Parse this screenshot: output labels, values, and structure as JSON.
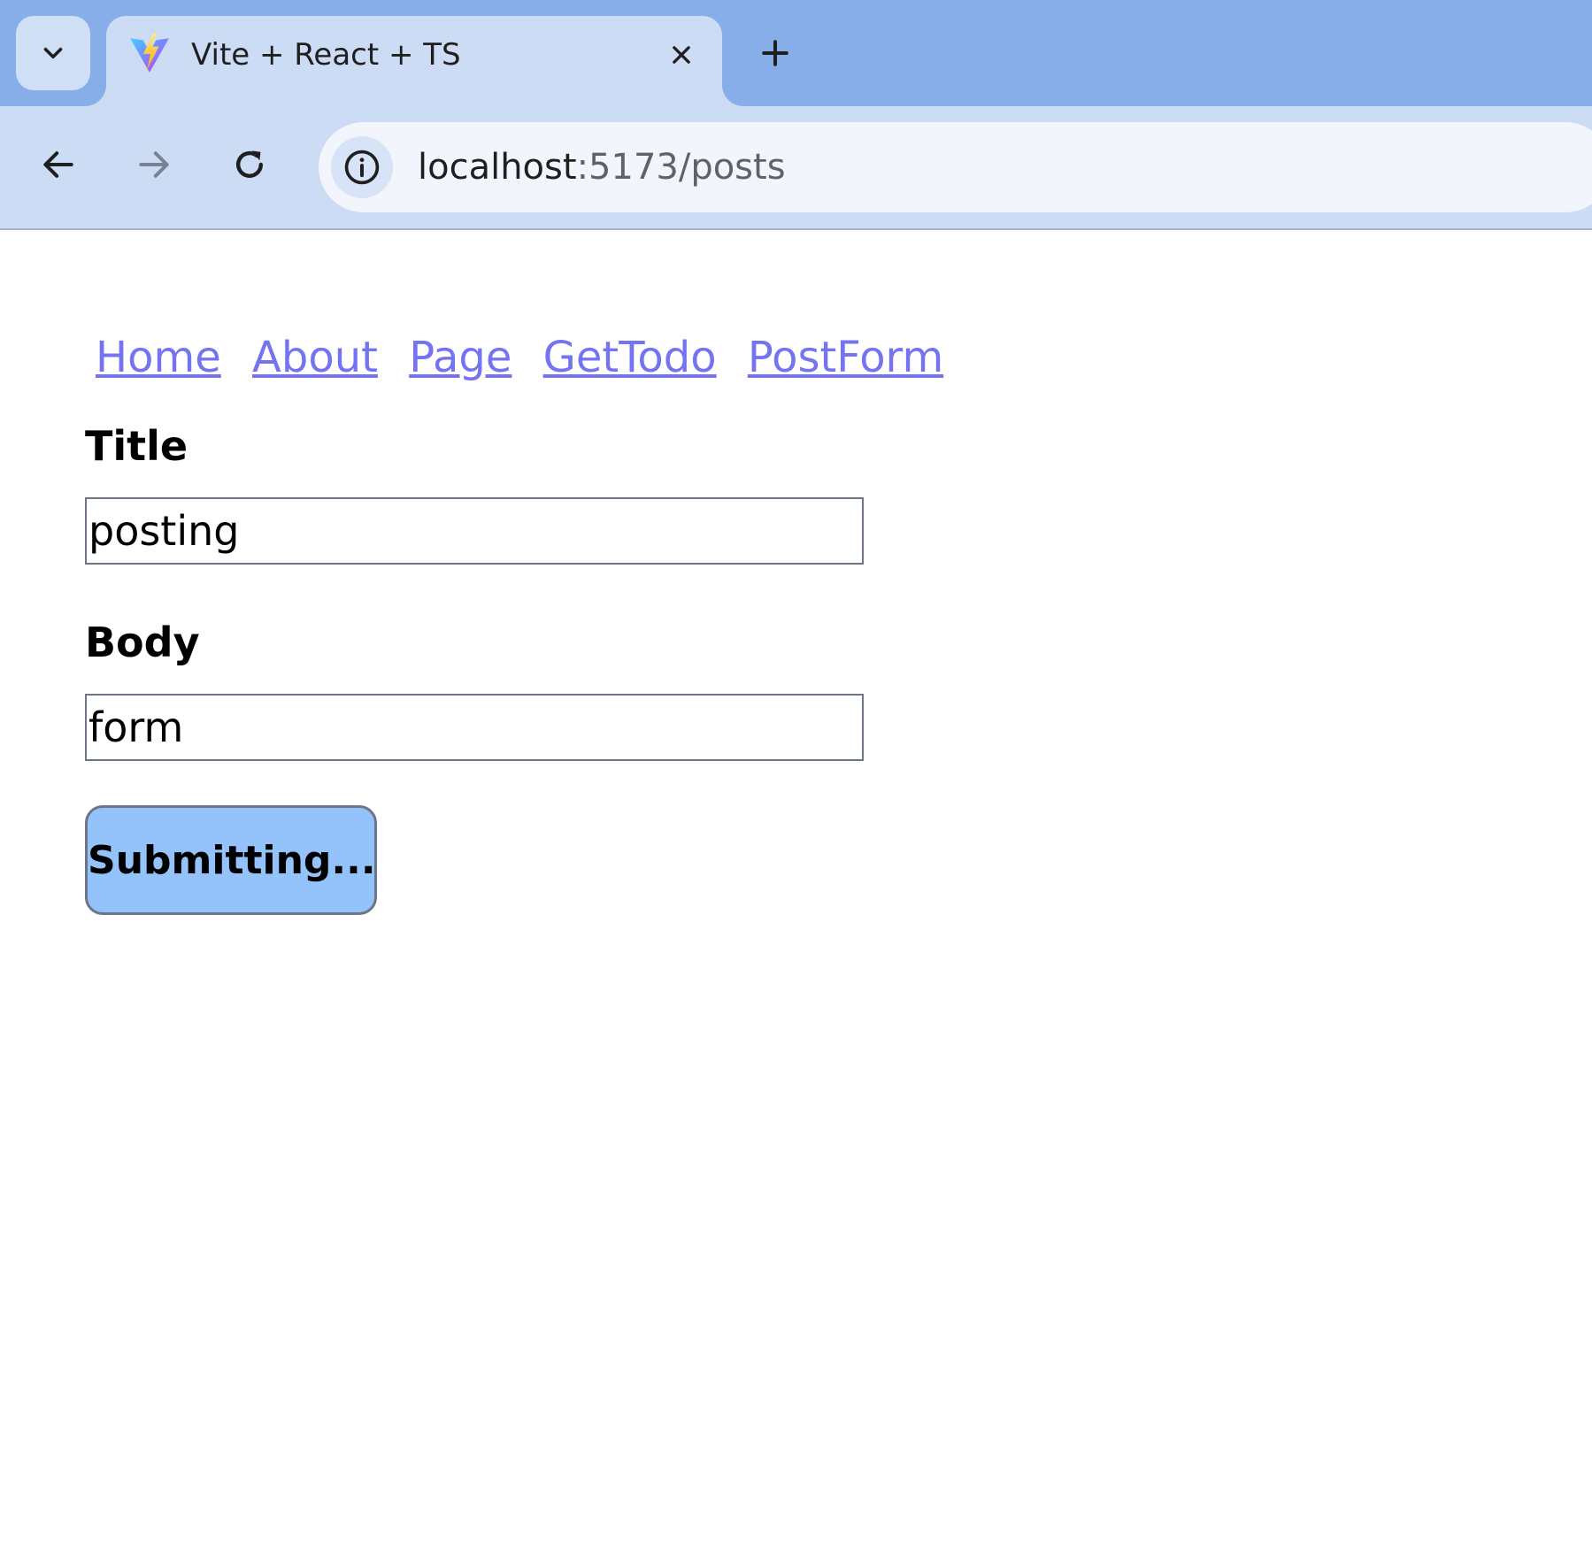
{
  "browser": {
    "tab": {
      "title": "Vite + React + TS"
    },
    "address_bar": {
      "host": "localhost",
      "rest": ":5173/posts"
    }
  },
  "nav": {
    "links": [
      "Home",
      "About",
      "Page",
      "GetTodo",
      "PostForm"
    ]
  },
  "form": {
    "title_label": "Title",
    "title_value": "posting",
    "body_label": "Body",
    "body_value": "form",
    "submit_label": "Submitting..."
  },
  "colors": {
    "link": "#7474f2",
    "submit_button": "#93c3fa",
    "tabstrip": "#88aeea",
    "toolbar": "#cddcf5"
  }
}
